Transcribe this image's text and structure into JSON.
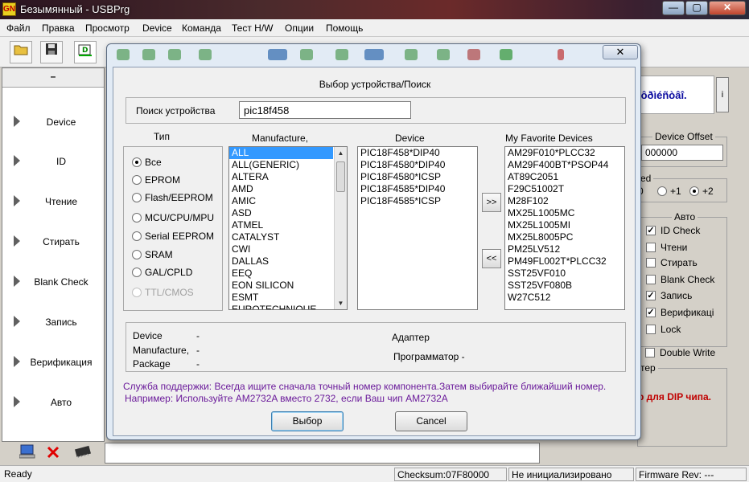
{
  "window": {
    "title": "Безымянный - USBPrg",
    "app_icon_text": "GN",
    "controls": [
      "—",
      "▢",
      "✕"
    ]
  },
  "menu": [
    "Файл",
    "Правка",
    "Просмотр",
    "Device",
    "Команда",
    "Тест H/W",
    "Опции",
    "Помощь"
  ],
  "left_panel": {
    "header": "–",
    "items": [
      "Device",
      "ID",
      "Чтение",
      "Стирать",
      "Blank Check",
      "Запись",
      "Верификация",
      "Авто"
    ]
  },
  "right_panel": {
    "banner_text": "ìôðìéñòâî.",
    "banner_button": "i",
    "device_offset_label": "Device Offset",
    "device_offset_value": "000000",
    "speed_title": "ed",
    "speed_options": [
      "0",
      "+1",
      "+2"
    ],
    "speed_selected": "+2",
    "auto_title": "Авто",
    "auto_options": [
      {
        "label": "ID Check",
        "checked": true
      },
      {
        "label": "Чтени",
        "checked": false
      },
      {
        "label": "Стирать",
        "checked": false
      },
      {
        "label": "Blank Check",
        "checked": false
      },
      {
        "label": "Запись",
        "checked": true
      },
      {
        "label": "Верификаці",
        "checked": true
      },
      {
        "label": "Lock",
        "checked": false
      }
    ],
    "double_write_label": "Double Write",
    "bottom_group_title": "тер",
    "bottom_note": "р для  DIP чипа."
  },
  "statusbar": {
    "ready": "Ready",
    "checksum": "Checksum:07F80000",
    "init_state": "Не инициализировано",
    "firmware": "Firmware Rev: ---"
  },
  "dialog": {
    "close_label": "✕",
    "heading": "Выбор устройства/Поиск",
    "search_label": "Поиск устройства",
    "search_value": "pic18f458",
    "type_header": "Тип",
    "types": [
      "Все",
      "EPROM",
      "Flash/EEPROM",
      "MCU/CPU/MPU",
      "Serial EEPROM",
      "SRAM",
      "GAL/CPLD",
      "TTL/CMOS"
    ],
    "type_selected": "Все",
    "manufacture_header": "Manufacture,",
    "manufacturers": [
      "ALL",
      "ALL(GENERIC)",
      "ALTERA",
      "AMD",
      "AMIC",
      "ASD",
      "ATMEL",
      "CATALYST",
      "CWI",
      "DALLAS",
      "EEQ",
      "EON SILICON",
      "ESMT",
      "EUROTECHNIQUE"
    ],
    "manufacturer_selected": "ALL",
    "device_header": "Device",
    "devices": [
      "PIC18F458*DIP40",
      "PIC18F4580*DIP40",
      "PIC18F4580*ICSP",
      "PIC18F4585*DIP40",
      "PIC18F4585*ICSP"
    ],
    "add_button": ">>",
    "remove_button": "<<",
    "favorites_header": "My Favorite Devices",
    "favorites": [
      "AM29F010*PLCC32",
      "AM29F400BT*PSOP44",
      "AT89C2051",
      "F29C51002T",
      "M28F102",
      "MX25L1005MC",
      "MX25L1005MI",
      "MX25L8005PC",
      "PM25LV512",
      "PM49FL002T*PLCC32",
      "SST25VF010",
      "SST25VF080B",
      "W27C512"
    ],
    "info": {
      "device_label": "Device",
      "device_value": "-",
      "manufacture_label": "Manufacture,",
      "manufacture_value": "-",
      "package_label": "Package",
      "package_value": "-",
      "adapter_label": "Адаптер",
      "programmer_label": "Программатор -"
    },
    "support_line1": "Служба поддержки: Всегда ищите сначала точный номер компонента.Затем выбирайте ближайший номер.",
    "support_line2": "Например: Используйте AM2732A вместо 2732, если Ваш чип AM2732A",
    "ok_button": "Выбор",
    "cancel_button": "Cancel"
  }
}
